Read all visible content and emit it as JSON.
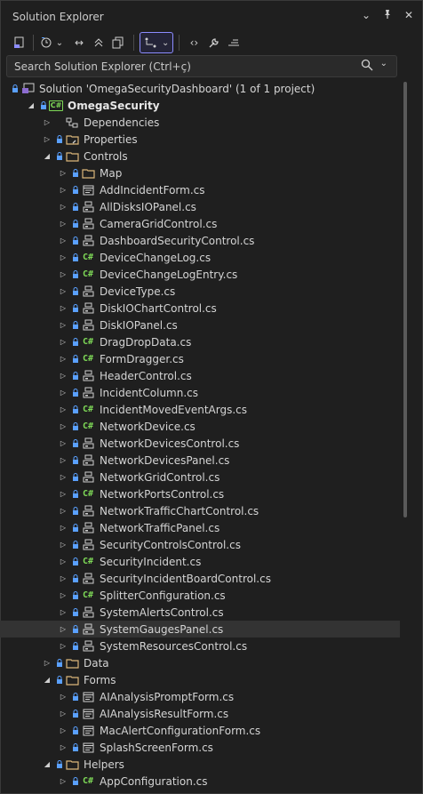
{
  "window": {
    "title": "Solution Explorer",
    "title_buttons": [
      "chevron-down-icon",
      "pin-icon",
      "close-icon"
    ]
  },
  "toolbar": {
    "icons": [
      "sync-with-active-document-icon",
      "pending-changes-filter-icon",
      "dropdown-icon",
      "sync-icon",
      "collapse-all-icon",
      "switch-views-icon",
      "filter-toggle-icon",
      "code-view-icon",
      "properties-wrench-icon",
      "preview-selected-items-icon"
    ]
  },
  "search": {
    "placeholder": "Search Solution Explorer (Ctrl+ç)"
  },
  "tree": [
    {
      "label": "Solution 'OmegaSecurityDashboard' (1 of 1 project)",
      "indent": 0,
      "chevron": "none",
      "icon": "solution",
      "locked": true,
      "bold": false
    },
    {
      "label": "OmegaSecurity",
      "indent": 1,
      "chevron": "open",
      "icon": "csproj",
      "locked": true,
      "bold": true
    },
    {
      "label": "Dependencies",
      "indent": 2,
      "chevron": "closed",
      "icon": "dependencies",
      "locked": false,
      "bold": false
    },
    {
      "label": "Properties",
      "indent": 2,
      "chevron": "closed",
      "icon": "folder-wrench",
      "locked": true,
      "bold": false
    },
    {
      "label": "Controls",
      "indent": 2,
      "chevron": "open",
      "icon": "folder",
      "locked": true,
      "bold": false
    },
    {
      "label": "Map",
      "indent": 3,
      "chevron": "closed",
      "icon": "folder",
      "locked": true,
      "bold": false
    },
    {
      "label": "AddIncidentForm.cs",
      "indent": 3,
      "chevron": "closed",
      "icon": "form",
      "locked": true,
      "bold": false
    },
    {
      "label": "AllDisksIOPanel.cs",
      "indent": 3,
      "chevron": "closed",
      "icon": "control",
      "locked": true,
      "bold": false
    },
    {
      "label": "CameraGridControl.cs",
      "indent": 3,
      "chevron": "closed",
      "icon": "control",
      "locked": true,
      "bold": false
    },
    {
      "label": "DashboardSecurityControl.cs",
      "indent": 3,
      "chevron": "closed",
      "icon": "control",
      "locked": true,
      "bold": false
    },
    {
      "label": "DeviceChangeLog.cs",
      "indent": 3,
      "chevron": "closed",
      "icon": "csharp",
      "locked": true,
      "bold": false
    },
    {
      "label": "DeviceChangeLogEntry.cs",
      "indent": 3,
      "chevron": "closed",
      "icon": "csharp",
      "locked": true,
      "bold": false
    },
    {
      "label": "DeviceType.cs",
      "indent": 3,
      "chevron": "closed",
      "icon": "control",
      "locked": true,
      "bold": false
    },
    {
      "label": "DiskIOChartControl.cs",
      "indent": 3,
      "chevron": "closed",
      "icon": "control",
      "locked": true,
      "bold": false
    },
    {
      "label": "DiskIOPanel.cs",
      "indent": 3,
      "chevron": "closed",
      "icon": "control",
      "locked": true,
      "bold": false
    },
    {
      "label": "DragDropData.cs",
      "indent": 3,
      "chevron": "closed",
      "icon": "csharp",
      "locked": true,
      "bold": false
    },
    {
      "label": "FormDragger.cs",
      "indent": 3,
      "chevron": "closed",
      "icon": "csharp",
      "locked": true,
      "bold": false
    },
    {
      "label": "HeaderControl.cs",
      "indent": 3,
      "chevron": "closed",
      "icon": "control",
      "locked": true,
      "bold": false
    },
    {
      "label": "IncidentColumn.cs",
      "indent": 3,
      "chevron": "closed",
      "icon": "control",
      "locked": true,
      "bold": false
    },
    {
      "label": "IncidentMovedEventArgs.cs",
      "indent": 3,
      "chevron": "closed",
      "icon": "csharp",
      "locked": true,
      "bold": false
    },
    {
      "label": "NetworkDevice.cs",
      "indent": 3,
      "chevron": "closed",
      "icon": "csharp",
      "locked": true,
      "bold": false
    },
    {
      "label": "NetworkDevicesControl.cs",
      "indent": 3,
      "chevron": "closed",
      "icon": "control",
      "locked": true,
      "bold": false
    },
    {
      "label": "NetworkDevicesPanel.cs",
      "indent": 3,
      "chevron": "closed",
      "icon": "control",
      "locked": true,
      "bold": false
    },
    {
      "label": "NetworkGridControl.cs",
      "indent": 3,
      "chevron": "closed",
      "icon": "control",
      "locked": true,
      "bold": false
    },
    {
      "label": "NetworkPortsControl.cs",
      "indent": 3,
      "chevron": "closed",
      "icon": "csharp",
      "locked": true,
      "bold": false
    },
    {
      "label": "NetworkTrafficChartControl.cs",
      "indent": 3,
      "chevron": "closed",
      "icon": "control",
      "locked": true,
      "bold": false
    },
    {
      "label": "NetworkTrafficPanel.cs",
      "indent": 3,
      "chevron": "closed",
      "icon": "control",
      "locked": true,
      "bold": false
    },
    {
      "label": "SecurityControlsControl.cs",
      "indent": 3,
      "chevron": "closed",
      "icon": "control",
      "locked": true,
      "bold": false
    },
    {
      "label": "SecurityIncident.cs",
      "indent": 3,
      "chevron": "closed",
      "icon": "csharp",
      "locked": true,
      "bold": false
    },
    {
      "label": "SecurityIncidentBoardControl.cs",
      "indent": 3,
      "chevron": "closed",
      "icon": "control",
      "locked": true,
      "bold": false
    },
    {
      "label": "SplitterConfiguration.cs",
      "indent": 3,
      "chevron": "closed",
      "icon": "csharp",
      "locked": true,
      "bold": false
    },
    {
      "label": "SystemAlertsControl.cs",
      "indent": 3,
      "chevron": "closed",
      "icon": "control",
      "locked": true,
      "bold": false
    },
    {
      "label": "SystemGaugesPanel.cs",
      "indent": 3,
      "chevron": "closed",
      "icon": "control",
      "locked": true,
      "bold": false,
      "selected": true
    },
    {
      "label": "SystemResourcesControl.cs",
      "indent": 3,
      "chevron": "closed",
      "icon": "control",
      "locked": true,
      "bold": false
    },
    {
      "label": "Data",
      "indent": 2,
      "chevron": "closed",
      "icon": "folder",
      "locked": true,
      "bold": false
    },
    {
      "label": "Forms",
      "indent": 2,
      "chevron": "open",
      "icon": "folder",
      "locked": true,
      "bold": false
    },
    {
      "label": "AIAnalysisPromptForm.cs",
      "indent": 3,
      "chevron": "closed",
      "icon": "form",
      "locked": true,
      "bold": false
    },
    {
      "label": "AIAnalysisResultForm.cs",
      "indent": 3,
      "chevron": "closed",
      "icon": "form",
      "locked": true,
      "bold": false
    },
    {
      "label": "MacAlertConfigurationForm.cs",
      "indent": 3,
      "chevron": "closed",
      "icon": "form",
      "locked": true,
      "bold": false
    },
    {
      "label": "SplashScreenForm.cs",
      "indent": 3,
      "chevron": "closed",
      "icon": "form",
      "locked": true,
      "bold": false
    },
    {
      "label": "Helpers",
      "indent": 2,
      "chevron": "open",
      "icon": "folder",
      "locked": true,
      "bold": false
    },
    {
      "label": "AppConfiguration.cs",
      "indent": 3,
      "chevron": "closed",
      "icon": "csharp",
      "locked": true,
      "bold": false
    }
  ],
  "colors": {
    "background": "#1f1f1f",
    "selected_row": "#333333",
    "lock": "#5aa0ff",
    "folder": "#dcb67a",
    "csharp": "#7ed957",
    "accent_box": "#8c8cff"
  }
}
